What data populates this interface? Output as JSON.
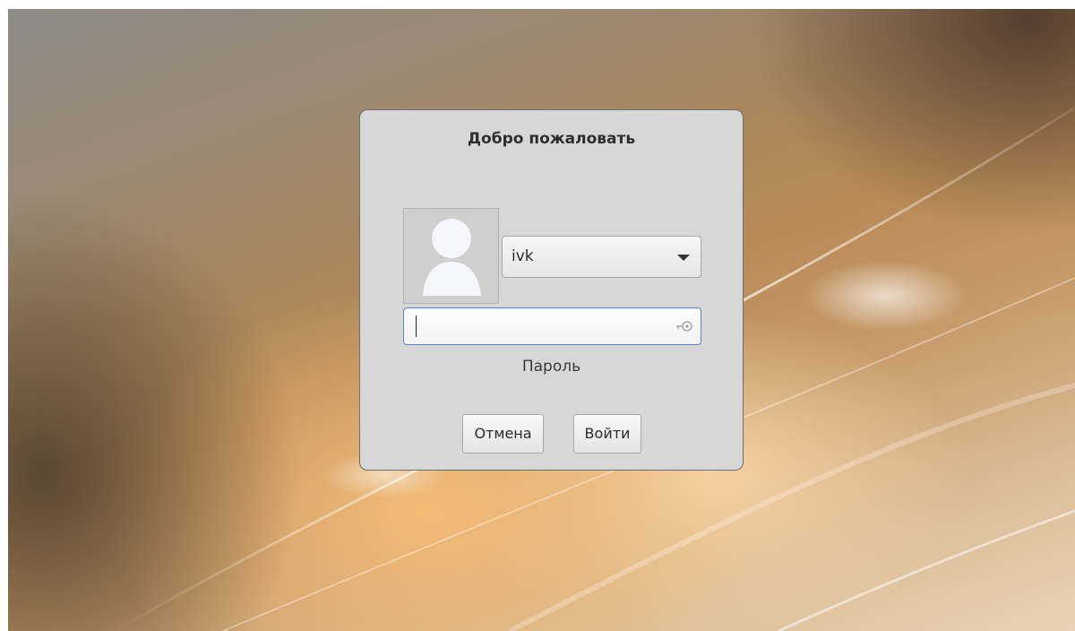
{
  "login_dialog": {
    "title": "Добро пожаловать",
    "user_select": {
      "selected": "ivk"
    },
    "password": {
      "value": "",
      "hint": "Пароль"
    },
    "buttons": {
      "cancel": "Отмена",
      "login": "Войти"
    },
    "icons": {
      "avatar": "user-avatar-icon",
      "dropdown": "chevron-down-icon",
      "password": "key-icon"
    }
  },
  "colors": {
    "dialog_bg": "#d7d7d7",
    "focus_border": "#5b86c7",
    "wallpaper_warm": "#c79a6a"
  }
}
